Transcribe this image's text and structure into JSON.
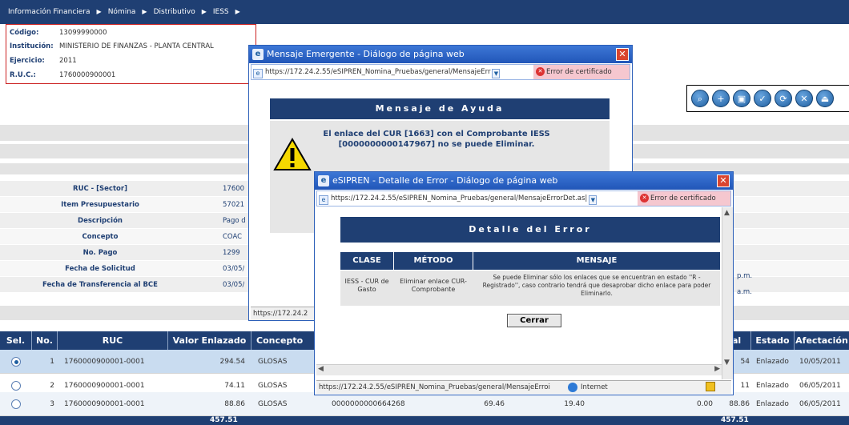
{
  "menu": [
    "Información Financiera",
    "Nómina",
    "Distributivo",
    "IESS"
  ],
  "menu_separator": "▶",
  "info": [
    {
      "label": "Código:",
      "value": "13099990000"
    },
    {
      "label": "Institución:",
      "value": "MINISTERIO DE FINANZAS - PLANTA CENTRAL"
    },
    {
      "label": "Ejercicio:",
      "value": "2011"
    },
    {
      "label": "R.U.C.:",
      "value": "1760000900001"
    }
  ],
  "toolbar_icons": [
    "preview-icon",
    "add-page-icon",
    "save-icon",
    "approve-icon",
    "refresh-icon",
    "cancel-icon",
    "exit-icon"
  ],
  "toolbar_glyphs": [
    "⌕",
    "+",
    "▣",
    "✓",
    "⟳",
    "✕",
    "⏏"
  ],
  "fields": [
    {
      "label": "RUC - [Sector]",
      "value": "17600"
    },
    {
      "label": "Item Presupuestario",
      "value": "57021"
    },
    {
      "label": "Descripción",
      "value": "Pago d"
    },
    {
      "label": "Concepto",
      "value": "COAC"
    },
    {
      "label": "No. Pago",
      "value": "1299"
    },
    {
      "label": "Fecha de Solicitud",
      "value": "03/05/"
    },
    {
      "label": "Fecha de Transferencia al BCE",
      "value": "03/05/"
    }
  ],
  "side_times": [
    "p.m.",
    "a.m."
  ],
  "table": {
    "headers": [
      "Sel.",
      "No.",
      "RUC",
      "Valor Enlazado",
      "Concepto",
      "al",
      "Estado",
      "Afectación"
    ],
    "rows": [
      {
        "selected": true,
        "no": "1",
        "ruc": "1760000900001-0001",
        "valor": "294.54",
        "concepto": "GLOSAS",
        "comprobante": "",
        "v1": "",
        "v2": "",
        "v3": "",
        "total": "54",
        "estado": "Enlazado",
        "afectacion": "10/05/2011"
      },
      {
        "selected": false,
        "no": "2",
        "ruc": "1760000900001-0001",
        "valor": "74.11",
        "concepto": "GLOSAS",
        "comprobante": "",
        "v1": "",
        "v2": "",
        "v3": "",
        "total": "11",
        "estado": "Enlazado",
        "afectacion": "06/05/2011"
      },
      {
        "selected": false,
        "no": "3",
        "ruc": "1760000900001-0001",
        "valor": "88.86",
        "concepto": "GLOSAS",
        "comprobante": "0000000000664268",
        "v1": "69.46",
        "v2": "19.40",
        "v3": "0.00",
        "total": "88.86",
        "estado": "Enlazado",
        "afectacion": "06/05/2011"
      }
    ],
    "footer": {
      "valor": "457.51",
      "total": "457.51"
    }
  },
  "dialog1": {
    "title": "Mensaje Emergente - Diálogo de página web",
    "url": "https://172.24.2.55/eSIPREN_Nomina_Pruebas/general/MensajeErr",
    "cert": "Error de certificado",
    "header": "Mensaje de Ayuda",
    "message": "El enlace del CUR [1663] con el Comprobante IESS [0000000000147967] no se puede Eliminar.",
    "status": "https://172.24.2"
  },
  "dialog2": {
    "title": "eSIPREN - Detalle de Error - Diálogo de página web",
    "url": "https://172.24.2.55/eSIPREN_Nomina_Pruebas/general/MensajeErrorDet.as|",
    "cert": "Error de certificado",
    "header": "Detalle del Error",
    "columns": [
      "CLASE",
      "MÉTODO",
      "MENSAJE"
    ],
    "row": {
      "clase": "IESS - CUR de Gasto",
      "metodo": "Eliminar enlace CUR-Comprobante",
      "mensaje": "Se puede Eliminar sólo los enlaces que se encuentran en estado ''R - Registrado'', caso contrario tendrá que desaprobar dicho enlace para poder Eliminarlo."
    },
    "button": "Cerrar",
    "status_url": "https://172.24.2.55/eSIPREN_Nomina_Pruebas/general/MensajeErroi",
    "zone": "Internet"
  },
  "colors": {
    "navy": "#1f3f73",
    "title_blue": "#2156b8",
    "cert_pink": "#f5c7cf",
    "info_border": "#cc2222"
  }
}
